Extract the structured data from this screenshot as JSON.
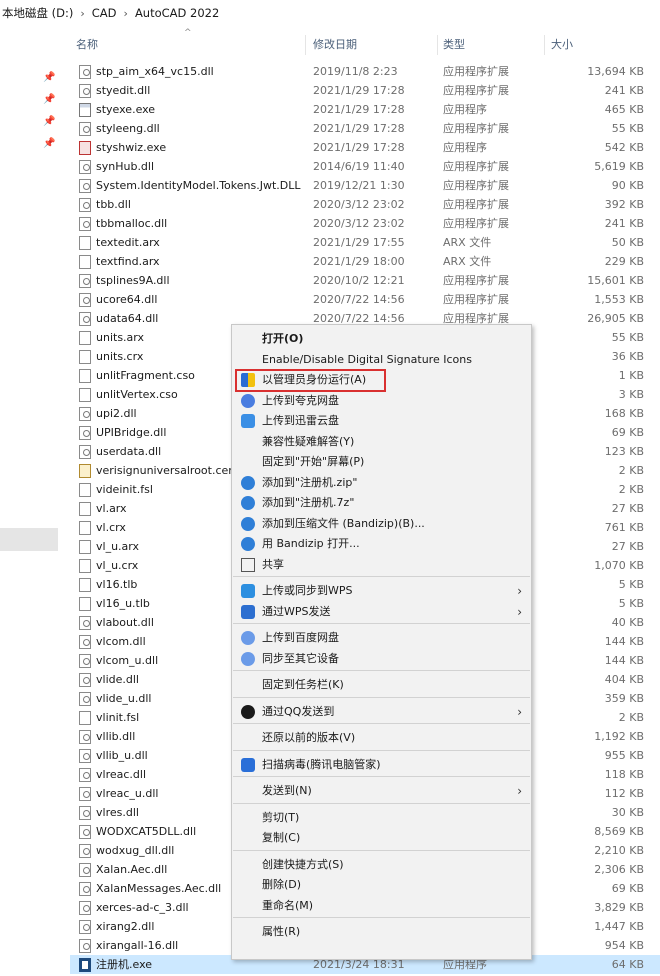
{
  "breadcrumb": [
    "本地磁盘 (D:)",
    "CAD",
    "AutoCAD 2022"
  ],
  "breadcrumb_sep": "›",
  "columns": {
    "name": "名称",
    "date": "修改日期",
    "type": "类型",
    "size": "大小"
  },
  "sort_arrow": "^",
  "files": [
    {
      "name": "stp_aim_x64_vc15.dll",
      "date": "2019/11/8 2:23",
      "type": "应用程序扩展",
      "size": "13,694 KB",
      "icon": "dll"
    },
    {
      "name": "styedit.dll",
      "date": "2021/1/29 17:28",
      "type": "应用程序扩展",
      "size": "241 KB",
      "icon": "dll"
    },
    {
      "name": "styexe.exe",
      "date": "2021/1/29 17:28",
      "type": "应用程序",
      "size": "465 KB",
      "icon": "exe"
    },
    {
      "name": "styleeng.dll",
      "date": "2021/1/29 17:28",
      "type": "应用程序扩展",
      "size": "55 KB",
      "icon": "dll"
    },
    {
      "name": "styshwiz.exe",
      "date": "2021/1/29 17:28",
      "type": "应用程序",
      "size": "542 KB",
      "icon": "exe-red"
    },
    {
      "name": "synHub.dll",
      "date": "2014/6/19 11:40",
      "type": "应用程序扩展",
      "size": "5,619 KB",
      "icon": "dll"
    },
    {
      "name": "System.IdentityModel.Tokens.Jwt.DLL",
      "date": "2019/12/21 1:30",
      "type": "应用程序扩展",
      "size": "90 KB",
      "icon": "dll"
    },
    {
      "name": "tbb.dll",
      "date": "2020/3/12 23:02",
      "type": "应用程序扩展",
      "size": "392 KB",
      "icon": "dll"
    },
    {
      "name": "tbbmalloc.dll",
      "date": "2020/3/12 23:02",
      "type": "应用程序扩展",
      "size": "241 KB",
      "icon": "dll"
    },
    {
      "name": "textedit.arx",
      "date": "2021/1/29 17:55",
      "type": "ARX 文件",
      "size": "50 KB",
      "icon": "file"
    },
    {
      "name": "textfind.arx",
      "date": "2021/1/29 18:00",
      "type": "ARX 文件",
      "size": "229 KB",
      "icon": "file"
    },
    {
      "name": "tsplines9A.dll",
      "date": "2020/10/2 12:21",
      "type": "应用程序扩展",
      "size": "15,601 KB",
      "icon": "dll"
    },
    {
      "name": "ucore64.dll",
      "date": "2020/7/22 14:56",
      "type": "应用程序扩展",
      "size": "1,553 KB",
      "icon": "dll"
    },
    {
      "name": "udata64.dll",
      "date": "2020/7/22 14:56",
      "type": "应用程序扩展",
      "size": "26,905 KB",
      "icon": "dll"
    },
    {
      "name": "units.arx",
      "date": "",
      "type": "",
      "size": "55 KB",
      "icon": "file"
    },
    {
      "name": "units.crx",
      "date": "",
      "type": "",
      "size": "36 KB",
      "icon": "file"
    },
    {
      "name": "unlitFragment.cso",
      "date": "",
      "type": "",
      "size": "1 KB",
      "icon": "file"
    },
    {
      "name": "unlitVertex.cso",
      "date": "",
      "type": "",
      "size": "3 KB",
      "icon": "file"
    },
    {
      "name": "upi2.dll",
      "date": "",
      "type": "",
      "size": "168 KB",
      "icon": "dll"
    },
    {
      "name": "UPIBridge.dll",
      "date": "",
      "type": "",
      "size": "69 KB",
      "icon": "dll"
    },
    {
      "name": "userdata.dll",
      "date": "",
      "type": "",
      "size": "123 KB",
      "icon": "dll"
    },
    {
      "name": "verisignuniversalroot.cer",
      "date": "",
      "type": "",
      "size": "2 KB",
      "icon": "cert"
    },
    {
      "name": "videinit.fsl",
      "date": "",
      "type": "",
      "size": "2 KB",
      "icon": "file"
    },
    {
      "name": "vl.arx",
      "date": "",
      "type": "",
      "size": "27 KB",
      "icon": "file"
    },
    {
      "name": "vl.crx",
      "date": "",
      "type": "",
      "size": "761 KB",
      "icon": "file"
    },
    {
      "name": "vl_u.arx",
      "date": "",
      "type": "",
      "size": "27 KB",
      "icon": "file"
    },
    {
      "name": "vl_u.crx",
      "date": "",
      "type": "",
      "size": "1,070 KB",
      "icon": "file"
    },
    {
      "name": "vl16.tlb",
      "date": "",
      "type": "",
      "size": "5 KB",
      "icon": "file"
    },
    {
      "name": "vl16_u.tlb",
      "date": "",
      "type": "",
      "size": "5 KB",
      "icon": "file"
    },
    {
      "name": "vlabout.dll",
      "date": "",
      "type": "",
      "size": "40 KB",
      "icon": "dll"
    },
    {
      "name": "vlcom.dll",
      "date": "",
      "type": "",
      "size": "144 KB",
      "icon": "dll"
    },
    {
      "name": "vlcom_u.dll",
      "date": "",
      "type": "",
      "size": "144 KB",
      "icon": "dll"
    },
    {
      "name": "vlide.dll",
      "date": "",
      "type": "",
      "size": "404 KB",
      "icon": "dll"
    },
    {
      "name": "vlide_u.dll",
      "date": "",
      "type": "",
      "size": "359 KB",
      "icon": "dll"
    },
    {
      "name": "vlinit.fsl",
      "date": "",
      "type": "",
      "size": "2 KB",
      "icon": "file"
    },
    {
      "name": "vllib.dll",
      "date": "",
      "type": "",
      "size": "1,192 KB",
      "icon": "dll"
    },
    {
      "name": "vllib_u.dll",
      "date": "",
      "type": "",
      "size": "955 KB",
      "icon": "dll"
    },
    {
      "name": "vlreac.dll",
      "date": "",
      "type": "",
      "size": "118 KB",
      "icon": "dll"
    },
    {
      "name": "vlreac_u.dll",
      "date": "",
      "type": "",
      "size": "112 KB",
      "icon": "dll"
    },
    {
      "name": "vlres.dll",
      "date": "",
      "type": "",
      "size": "30 KB",
      "icon": "dll"
    },
    {
      "name": "WODXCAT5DLL.dll",
      "date": "",
      "type": "",
      "size": "8,569 KB",
      "icon": "dll"
    },
    {
      "name": "wodxug_dll.dll",
      "date": "",
      "type": "",
      "size": "2,210 KB",
      "icon": "dll"
    },
    {
      "name": "Xalan.Aec.dll",
      "date": "",
      "type": "",
      "size": "2,306 KB",
      "icon": "dll"
    },
    {
      "name": "XalanMessages.Aec.dll",
      "date": "",
      "type": "",
      "size": "69 KB",
      "icon": "dll"
    },
    {
      "name": "xerces-ad-c_3.dll",
      "date": "",
      "type": "",
      "size": "3,829 KB",
      "icon": "dll"
    },
    {
      "name": "xirang2.dll",
      "date": "",
      "type": "",
      "size": "1,447 KB",
      "icon": "dll"
    },
    {
      "name": "xirangall-16.dll",
      "date": "",
      "type": "",
      "size": "954 KB",
      "icon": "dll"
    },
    {
      "name": "注册机.exe",
      "date": "2021/3/24 18:31",
      "type": "应用程序",
      "size": "64 KB",
      "icon": "reg",
      "selected": true
    }
  ],
  "context_menu": {
    "submenu_arrow": "›",
    "items": [
      {
        "label": "打开(O)",
        "bold": true,
        "icon": "",
        "sep_after": false,
        "submenu": false
      },
      {
        "label": "Enable/Disable Digital Signature Icons",
        "icon": "",
        "sep_after": false,
        "submenu": false
      },
      {
        "label": "以管理员身份运行(A)",
        "icon": "shield-icon",
        "highlight": true,
        "sep_after": false,
        "submenu": false
      },
      {
        "label": "上传到夸克网盘",
        "icon": "cloud-blue-icon",
        "sep_after": false,
        "submenu": false
      },
      {
        "label": "上传到迅雷云盘",
        "icon": "xunlei-icon",
        "sep_after": false,
        "submenu": false
      },
      {
        "label": "兼容性疑难解答(Y)",
        "icon": "",
        "sep_after": false,
        "submenu": false
      },
      {
        "label": "固定到\"开始\"屏幕(P)",
        "icon": "",
        "sep_after": false,
        "submenu": false
      },
      {
        "label": "添加到\"注册机.zip\"",
        "icon": "bandizip-icon",
        "sep_after": false,
        "submenu": false
      },
      {
        "label": "添加到\"注册机.7z\"",
        "icon": "bandizip-icon",
        "sep_after": false,
        "submenu": false
      },
      {
        "label": "添加到压缩文件 (Bandizip)(B)...",
        "icon": "bandizip-icon",
        "sep_after": false,
        "submenu": false
      },
      {
        "label": "用 Bandizip 打开...",
        "icon": "bandizip-icon",
        "sep_after": false,
        "submenu": false
      },
      {
        "label": "共享",
        "icon": "share-icon",
        "sep_after": true,
        "submenu": false
      },
      {
        "label": "上传或同步到WPS",
        "icon": "wps-icon",
        "sep_after": false,
        "submenu": true
      },
      {
        "label": "通过WPS发送",
        "icon": "wps-send-icon",
        "sep_after": true,
        "submenu": true
      },
      {
        "label": "上传到百度网盘",
        "icon": "baidu-icon",
        "sep_after": false,
        "submenu": false
      },
      {
        "label": "同步至其它设备",
        "icon": "baidu-icon",
        "sep_after": true,
        "submenu": false
      },
      {
        "label": "固定到任务栏(K)",
        "icon": "",
        "sep_after": true,
        "submenu": false
      },
      {
        "label": "通过QQ发送到",
        "icon": "qq-icon",
        "sep_after": true,
        "submenu": true
      },
      {
        "label": "还原以前的版本(V)",
        "icon": "",
        "sep_after": true,
        "submenu": false
      },
      {
        "label": "扫描病毒(腾讯电脑管家)",
        "icon": "tencent-icon",
        "sep_after": true,
        "submenu": false
      },
      {
        "label": "发送到(N)",
        "icon": "",
        "sep_after": true,
        "submenu": true
      },
      {
        "label": "剪切(T)",
        "icon": "",
        "sep_after": false,
        "submenu": false
      },
      {
        "label": "复制(C)",
        "icon": "",
        "sep_after": true,
        "submenu": false
      },
      {
        "label": "创建快捷方式(S)",
        "icon": "",
        "sep_after": false,
        "submenu": false
      },
      {
        "label": "删除(D)",
        "icon": "",
        "sep_after": false,
        "submenu": false
      },
      {
        "label": "重命名(M)",
        "icon": "",
        "sep_after": true,
        "submenu": false
      },
      {
        "label": "属性(R)",
        "icon": "",
        "sep_after": false,
        "submenu": false
      }
    ]
  },
  "colors": {
    "selection": "#cce8ff",
    "highlight_box": "#d93030",
    "menu_bg": "#f2f2f2"
  }
}
